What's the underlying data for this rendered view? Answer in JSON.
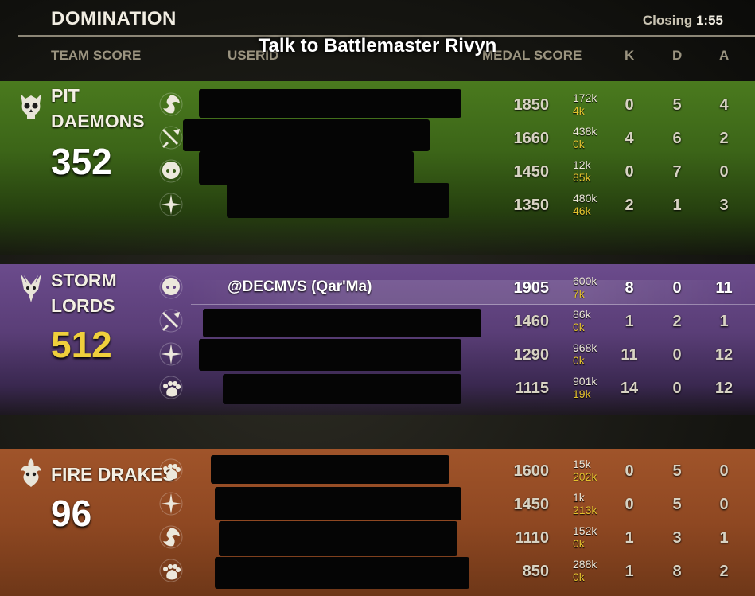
{
  "header": {
    "mode": "DOMINATION",
    "closing_label": "Closing",
    "closing_time": "1:55",
    "prompt": "Talk to Battlemaster Rivyn"
  },
  "columns": {
    "team_score": "TEAM SCORE",
    "userid": "USERID",
    "medal_score": "MEDAL SCORE",
    "k": "K",
    "d": "D",
    "a": "A"
  },
  "teams": [
    {
      "name_line1": "PIT",
      "name_line2": "DAEMONS",
      "score": "352",
      "icon": "pit-daemons-skull-icon",
      "color": "#4a7a1e",
      "players": [
        {
          "class_icon": "dragonknight-icon",
          "userid": "",
          "medal": "1850",
          "damage": "172k",
          "healing": "4k",
          "k": "0",
          "d": "5",
          "a": "4"
        },
        {
          "class_icon": "nightblade-icon",
          "userid": "",
          "medal": "1660",
          "damage": "438k",
          "healing": "0k",
          "k": "4",
          "d": "6",
          "a": "2"
        },
        {
          "class_icon": "necromancer-icon",
          "userid": "",
          "medal": "1450",
          "damage": "12k",
          "healing": "85k",
          "k": "0",
          "d": "7",
          "a": "0"
        },
        {
          "class_icon": "templar-icon",
          "userid": "",
          "medal": "1350",
          "damage": "480k",
          "healing": "46k",
          "k": "2",
          "d": "1",
          "a": "3"
        }
      ]
    },
    {
      "name_line1": "STORM",
      "name_line2": "LORDS",
      "score": "512",
      "icon": "storm-lords-icon",
      "color": "#6b4b8c",
      "players": [
        {
          "class_icon": "necromancer-icon",
          "userid": "@DECMVS (Qar'Ma)",
          "medal": "1905",
          "damage": "600k",
          "healing": "7k",
          "k": "8",
          "d": "0",
          "a": "11"
        },
        {
          "class_icon": "nightblade-icon",
          "userid": "",
          "medal": "1460",
          "damage": "86k",
          "healing": "0k",
          "k": "1",
          "d": "2",
          "a": "1"
        },
        {
          "class_icon": "templar-icon",
          "userid": "",
          "medal": "1290",
          "damage": "968k",
          "healing": "0k",
          "k": "11",
          "d": "0",
          "a": "12"
        },
        {
          "class_icon": "warden-icon",
          "userid": "",
          "medal": "1115",
          "damage": "901k",
          "healing": "19k",
          "k": "14",
          "d": "0",
          "a": "12"
        }
      ]
    },
    {
      "name_line1": "FIRE DRAKES",
      "name_line2": "",
      "score": "96",
      "icon": "fire-drakes-icon",
      "color": "#a0542a",
      "players": [
        {
          "class_icon": "warden-icon",
          "userid": "",
          "medal": "1600",
          "damage": "15k",
          "healing": "202k",
          "k": "0",
          "d": "5",
          "a": "0"
        },
        {
          "class_icon": "templar-icon",
          "userid": "",
          "medal": "1450",
          "damage": "1k",
          "healing": "213k",
          "k": "0",
          "d": "5",
          "a": "0"
        },
        {
          "class_icon": "dragonknight-icon",
          "userid": "",
          "medal": "1110",
          "damage": "152k",
          "healing": "0k",
          "k": "1",
          "d": "3",
          "a": "1"
        },
        {
          "class_icon": "warden-icon",
          "userid": "",
          "medal": "850",
          "damage": "288k",
          "healing": "0k",
          "k": "1",
          "d": "8",
          "a": "2"
        }
      ]
    }
  ]
}
